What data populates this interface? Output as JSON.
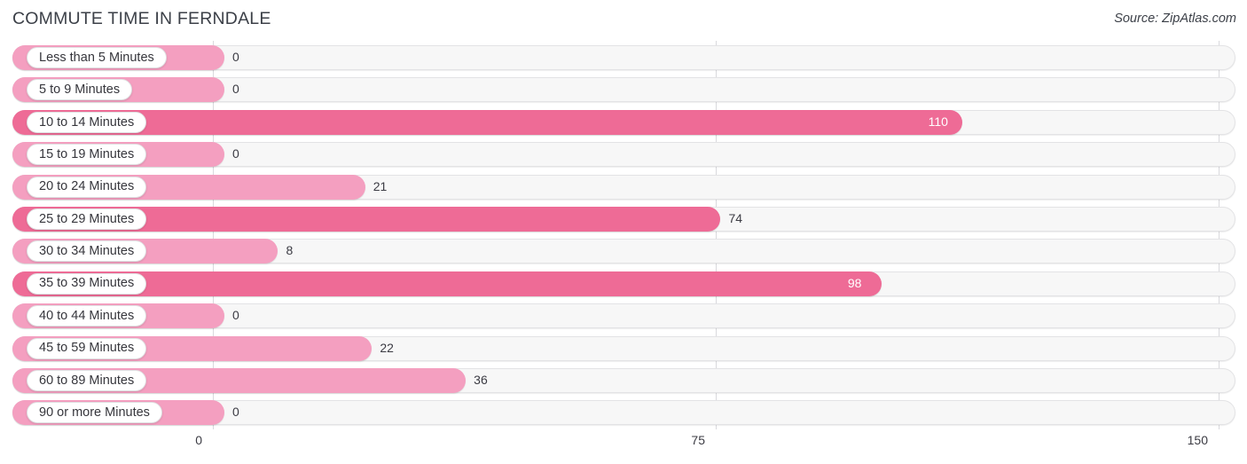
{
  "header": {
    "title": "COMMUTE TIME IN FERNDALE",
    "source": "Source: ZipAtlas.com"
  },
  "colors": {
    "bar_light": "#f49fc0",
    "bar_dark": "#ee6b96",
    "track": "#f7f7f7",
    "gridline": "#d9d9dd",
    "text": "#3b3b43"
  },
  "chart_data": {
    "type": "bar",
    "orientation": "horizontal",
    "title": "COMMUTE TIME IN FERNDALE",
    "xlabel": "",
    "ylabel": "",
    "xlim": [
      0,
      150
    ],
    "grid": true,
    "legend": "none",
    "xticks": [
      "0",
      "75",
      "150"
    ],
    "xtick_values": [
      0,
      75,
      150
    ],
    "categories": [
      "Less than 5 Minutes",
      "5 to 9 Minutes",
      "10 to 14 Minutes",
      "15 to 19 Minutes",
      "20 to 24 Minutes",
      "25 to 29 Minutes",
      "30 to 34 Minutes",
      "35 to 39 Minutes",
      "40 to 44 Minutes",
      "45 to 59 Minutes",
      "60 to 89 Minutes",
      "90 or more Minutes"
    ],
    "values": [
      0,
      0,
      110,
      0,
      21,
      74,
      8,
      98,
      0,
      22,
      36,
      0
    ],
    "value_labels": [
      "0",
      "0",
      "110",
      "0",
      "21",
      "74",
      "8",
      "98",
      "0",
      "22",
      "36",
      "0"
    ],
    "rows": [
      {
        "label": "Less than 5 Minutes",
        "value": 0,
        "display": "0",
        "tone": "light",
        "label_position": "outside"
      },
      {
        "label": "5 to 9 Minutes",
        "value": 0,
        "display": "0",
        "tone": "light",
        "label_position": "outside"
      },
      {
        "label": "10 to 14 Minutes",
        "value": 110,
        "display": "110",
        "tone": "dark",
        "label_position": "inside"
      },
      {
        "label": "15 to 19 Minutes",
        "value": 0,
        "display": "0",
        "tone": "light",
        "label_position": "outside"
      },
      {
        "label": "20 to 24 Minutes",
        "value": 21,
        "display": "21",
        "tone": "light",
        "label_position": "outside"
      },
      {
        "label": "25 to 29 Minutes",
        "value": 74,
        "display": "74",
        "tone": "dark",
        "label_position": "outside"
      },
      {
        "label": "30 to 34 Minutes",
        "value": 8,
        "display": "8",
        "tone": "light",
        "label_position": "outside"
      },
      {
        "label": "35 to 39 Minutes",
        "value": 98,
        "display": "98",
        "tone": "dark",
        "label_position": "inside"
      },
      {
        "label": "40 to 44 Minutes",
        "value": 0,
        "display": "0",
        "tone": "light",
        "label_position": "outside"
      },
      {
        "label": "45 to 59 Minutes",
        "value": 22,
        "display": "22",
        "tone": "light",
        "label_position": "outside"
      },
      {
        "label": "60 to 89 Minutes",
        "value": 36,
        "display": "36",
        "tone": "light",
        "label_position": "outside"
      },
      {
        "label": "90 or more Minutes",
        "value": 0,
        "display": "0",
        "tone": "light",
        "label_position": "outside"
      }
    ]
  }
}
